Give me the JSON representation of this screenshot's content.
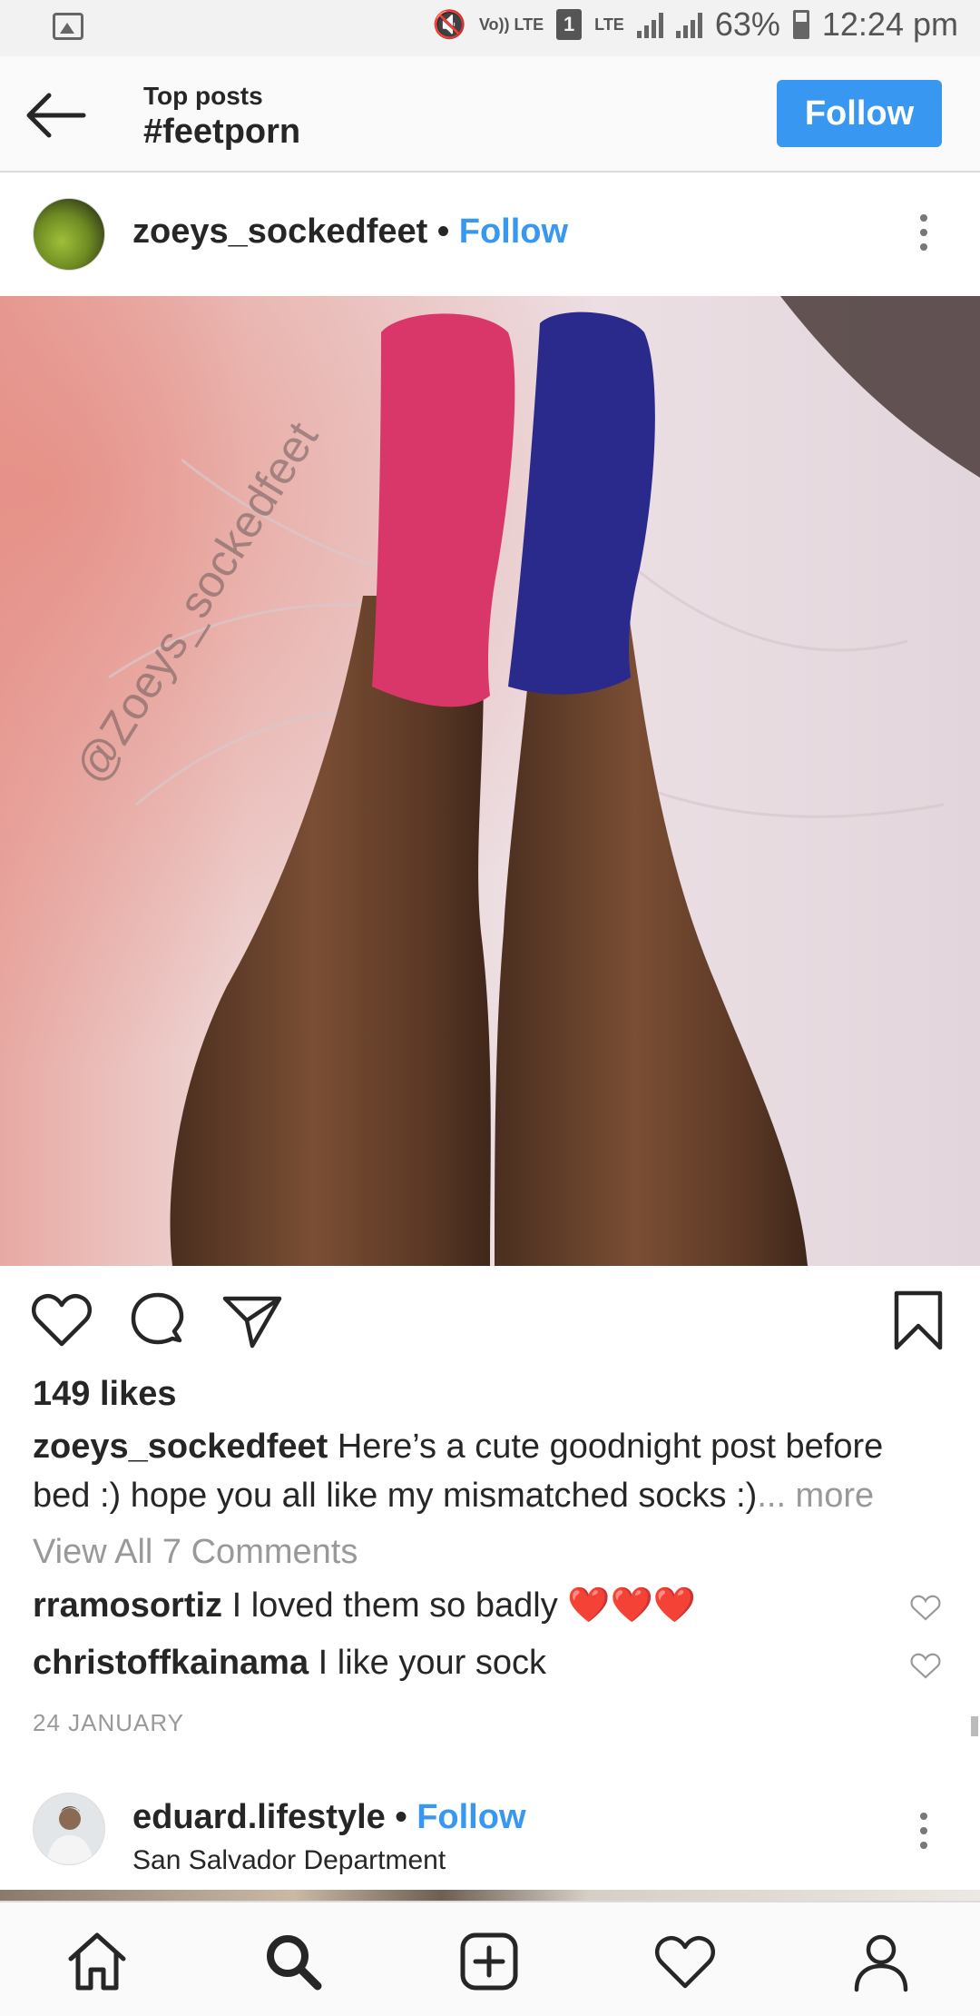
{
  "status_bar": {
    "volte": "Vo)) LTE",
    "sim": "1",
    "network": "LTE",
    "battery": "63%",
    "time": "12:24 pm"
  },
  "header": {
    "subtitle": "Top posts",
    "title": "#feetporn",
    "follow_label": "Follow"
  },
  "post": {
    "username": "zoeys_sockedfeet",
    "separator": "•",
    "follow_label": "Follow",
    "watermark": "@Zoeys_sockedfeet",
    "likes": "149 likes",
    "caption_user": "zoeys_sockedfeet",
    "caption_text": "Here’s a cute goodnight post before bed :) hope you all like my mismatched socks :)",
    "caption_more": "... more",
    "view_all": "View All 7 Comments",
    "comments": [
      {
        "user": "rramosortiz",
        "text": "I loved them so badly ❤️❤️❤️"
      },
      {
        "user": "christoffkainama",
        "text": "I like your sock"
      }
    ],
    "date": "24 JANUARY"
  },
  "next_post": {
    "username": "eduard.lifestyle",
    "separator": "•",
    "follow_label": "Follow",
    "location": "San Salvador Department"
  },
  "icons": {
    "back": "arrow-left-icon",
    "like": "heart-icon",
    "comment": "comment-bubble-icon",
    "share": "paper-plane-icon",
    "save": "bookmark-icon",
    "home": "home-icon",
    "search": "search-icon",
    "add": "add-square-icon",
    "activity": "heart-icon",
    "profile": "profile-icon"
  },
  "colors": {
    "accent": "#3897f0",
    "text": "#262626",
    "muted": "#999999"
  }
}
